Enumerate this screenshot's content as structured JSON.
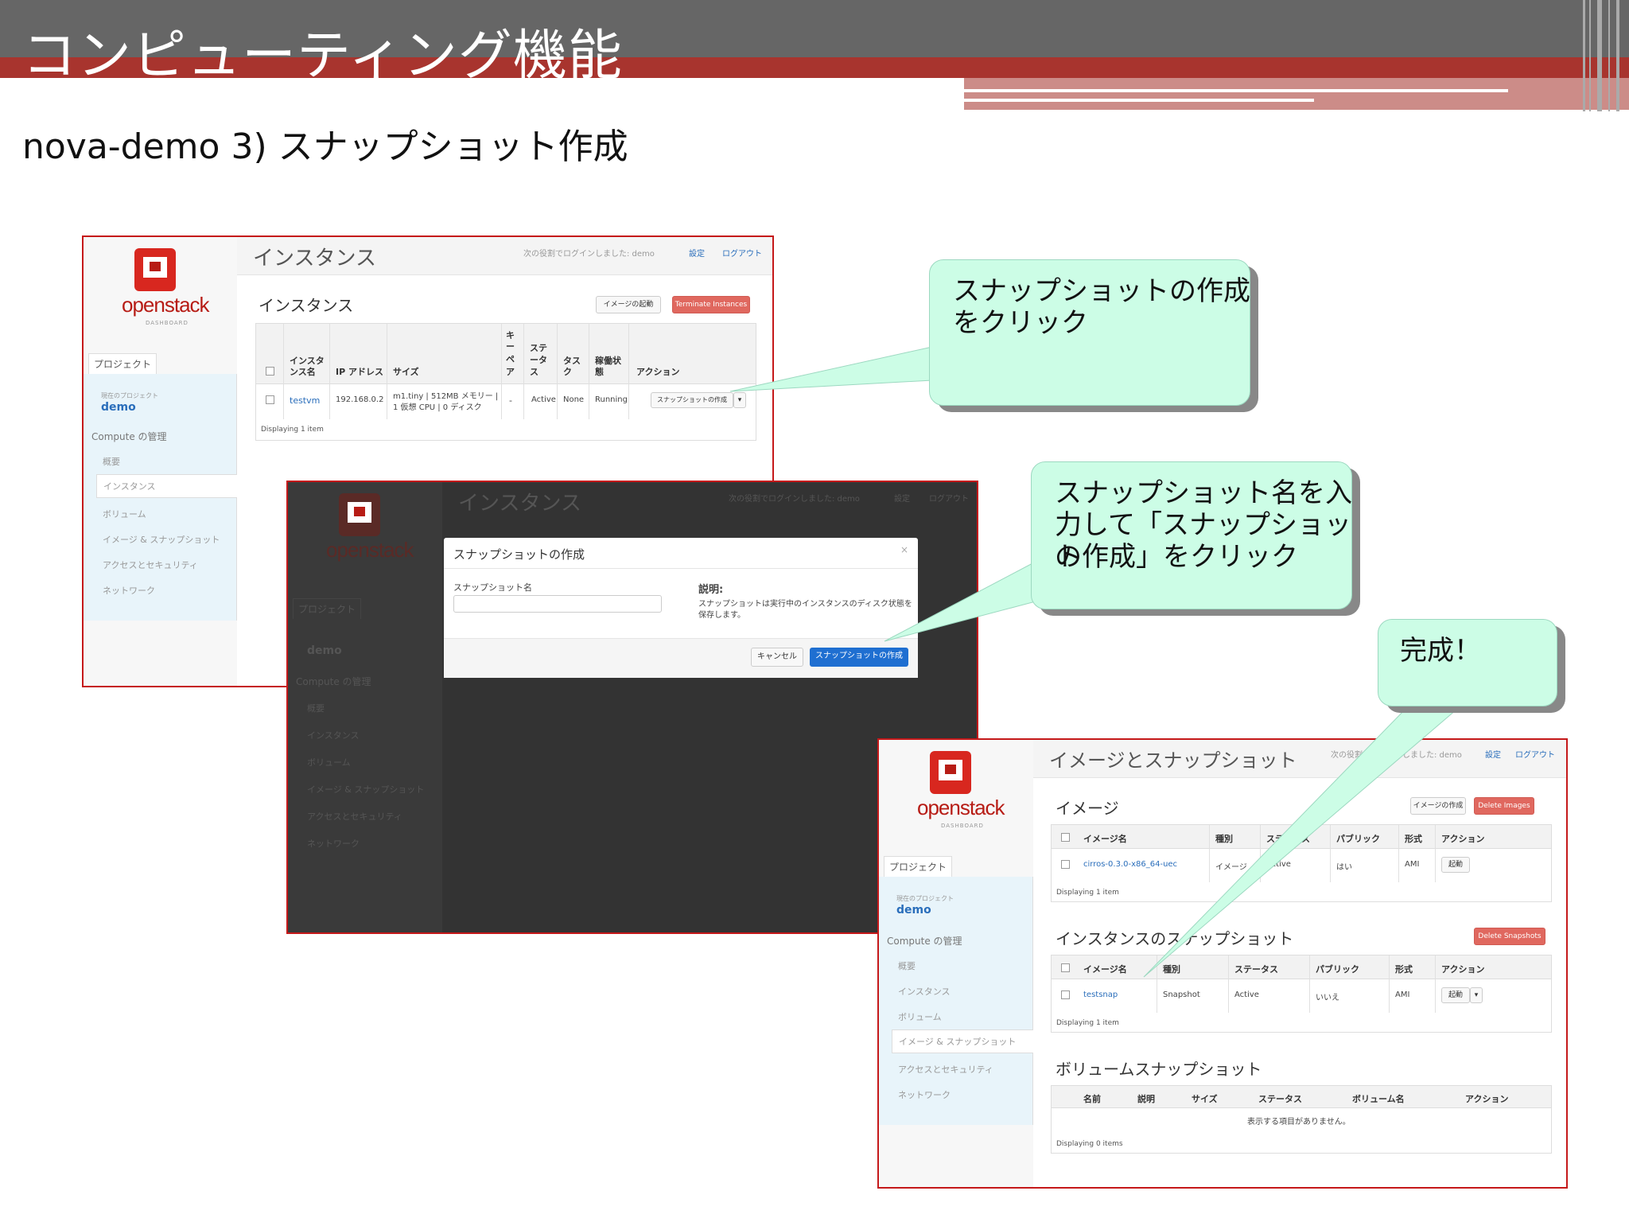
{
  "slide": {
    "title": "コンピューティング機能",
    "subtitle": "nova-demo 3) スナップショット作成"
  },
  "panel1": {
    "logo_text": "openstack",
    "logo_sub": "DASHBOARD",
    "project_tab": "プロジェクト",
    "current_project_label": "現在のプロジェクト",
    "current_project": "demo",
    "compute_heading": "Compute の管理",
    "nav": [
      "概要",
      "インスタンス",
      "ボリューム",
      "イメージ & スナップショット",
      "アクセスとセキュリティ",
      "ネットワーク"
    ],
    "page_title": "インスタンス",
    "logged_in": "次の役割でログインしました: demo",
    "settings": "設定",
    "logout": "ログアウト",
    "section_title": "インスタンス",
    "launch_button": "イメージの起動",
    "terminate_button": "Terminate Instances",
    "columns": [
      "インスタンス名",
      "IP アドレス",
      "サイズ",
      "キーペア",
      "ステータス",
      "タスク",
      "稼働状態",
      "アクション"
    ],
    "col_instance_l1": "インスタ",
    "col_instance_l2": "ンス名",
    "col_key_chars": [
      "キ",
      "ー",
      "ペ",
      "ア"
    ],
    "col_status_l1": "ステ",
    "col_status_l2": "ータ",
    "col_status_l3": "ス",
    "col_task_l1": "タス",
    "col_task_l2": "ク",
    "col_power_l1": "稼働状",
    "col_power_l2": "態",
    "row": {
      "name": "testvm",
      "ip": "192.168.0.2",
      "size_l1": "m1.tiny | 512MB メモリー |",
      "size_l2": "1 仮想 CPU | 0 ディスク",
      "key": "-",
      "status": "Active",
      "task": "None",
      "power": "Running",
      "action": "スナップショットの作成"
    },
    "footer": "Displaying 1 item"
  },
  "panel2": {
    "logo_text": "openstack",
    "page_title": "インスタンス",
    "logged_in": "次の役割でログインしました: demo",
    "settings": "設定",
    "logout": "ログアウト",
    "project_tab": "プロジェクト",
    "current_project": "demo",
    "compute_heading": "Compute の管理",
    "nav": [
      "概要",
      "インスタンス",
      "ボリューム",
      "イメージ & スナップショット",
      "アクセスとセキュリティ",
      "ネットワーク"
    ],
    "modal": {
      "title": "スナップショットの作成",
      "close": "×",
      "field_label": "スナップショット名",
      "field_value": "",
      "desc_title": "説明:",
      "desc_l1": "スナップショットは実行中のインスタンスのディスク状態を",
      "desc_l2": "保存します。",
      "cancel": "キャンセル",
      "submit": "スナップショットの作成"
    }
  },
  "panel3": {
    "logo_text": "openstack",
    "logo_sub": "DASHBOARD",
    "project_tab": "プロジェクト",
    "current_project_label": "現在のプロジェクト",
    "current_project": "demo",
    "compute_heading": "Compute の管理",
    "nav": [
      "概要",
      "インスタンス",
      "ボリューム",
      "イメージ & スナップショット",
      "アクセスとセキュリティ",
      "ネットワーク"
    ],
    "page_title": "イメージとスナップショット",
    "logged_in": "次の役割でログインしました: demo",
    "settings": "設定",
    "logout": "ログアウト",
    "images": {
      "title": "イメージ",
      "create_button": "イメージの作成",
      "delete_button": "Delete Images",
      "columns": [
        "イメージ名",
        "種別",
        "ステータス",
        "パブリック",
        "形式",
        "アクション"
      ],
      "row": {
        "name": "cirros-0.3.0-x86_64-uec",
        "type": "イメージ",
        "status": "Active",
        "public": "はい",
        "format": "AMI",
        "action": "起動"
      },
      "footer": "Displaying 1 item"
    },
    "snapshots": {
      "title": "インスタンスのスナップショット",
      "delete_button": "Delete Snapshots",
      "columns": [
        "イメージ名",
        "種別",
        "ステータス",
        "パブリック",
        "形式",
        "アクション"
      ],
      "row": {
        "name": "testsnap",
        "type": "Snapshot",
        "status": "Active",
        "public": "いいえ",
        "format": "AMI",
        "action": "起動"
      },
      "footer": "Displaying 1 item"
    },
    "volume_snapshots": {
      "title": "ボリュームスナップショット",
      "columns": [
        "名前",
        "説明",
        "サイズ",
        "ステータス",
        "ボリューム名",
        "アクション"
      ],
      "empty": "表示する項目がありません。",
      "footer": "Displaying 0 items"
    }
  },
  "callouts": {
    "c1_l1": "スナップショットの作成",
    "c1_l2": "をクリック",
    "c2_l1": "スナップショット名を入",
    "c2_l2": "力して「スナップショット",
    "c2_l3": "の作成」をクリック",
    "c3": "完成！"
  },
  "colors": {
    "header_gray": "#666666",
    "header_red": "#a8342e",
    "callout_fill": "#ccfde6",
    "frame_red": "#c5191a",
    "openstack_red": "#d8271f",
    "primary_blue": "#1f6fd1"
  }
}
